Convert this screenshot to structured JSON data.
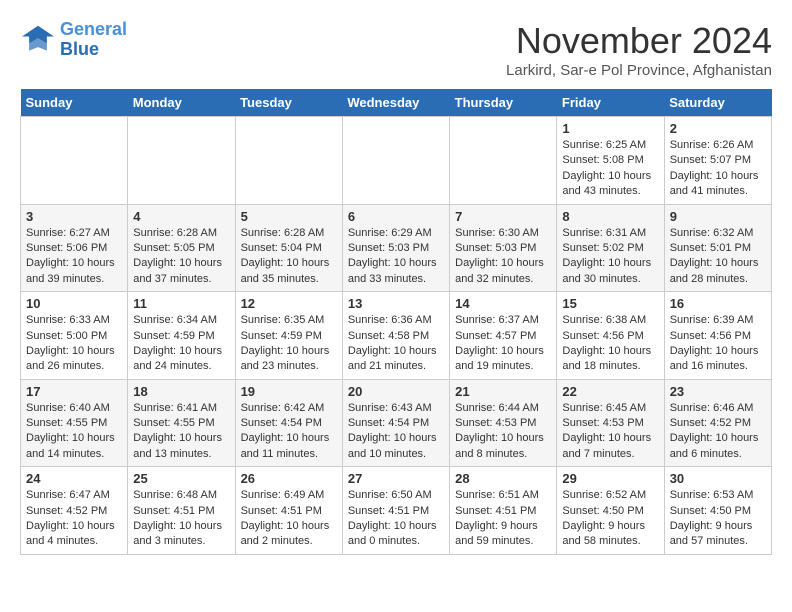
{
  "header": {
    "logo_line1": "General",
    "logo_line2": "Blue",
    "month": "November 2024",
    "location": "Larkird, Sar-e Pol Province, Afghanistan"
  },
  "weekdays": [
    "Sunday",
    "Monday",
    "Tuesday",
    "Wednesday",
    "Thursday",
    "Friday",
    "Saturday"
  ],
  "weeks": [
    [
      {
        "day": "",
        "info": ""
      },
      {
        "day": "",
        "info": ""
      },
      {
        "day": "",
        "info": ""
      },
      {
        "day": "",
        "info": ""
      },
      {
        "day": "",
        "info": ""
      },
      {
        "day": "1",
        "info": "Sunrise: 6:25 AM\nSunset: 5:08 PM\nDaylight: 10 hours and 43 minutes."
      },
      {
        "day": "2",
        "info": "Sunrise: 6:26 AM\nSunset: 5:07 PM\nDaylight: 10 hours and 41 minutes."
      }
    ],
    [
      {
        "day": "3",
        "info": "Sunrise: 6:27 AM\nSunset: 5:06 PM\nDaylight: 10 hours and 39 minutes."
      },
      {
        "day": "4",
        "info": "Sunrise: 6:28 AM\nSunset: 5:05 PM\nDaylight: 10 hours and 37 minutes."
      },
      {
        "day": "5",
        "info": "Sunrise: 6:28 AM\nSunset: 5:04 PM\nDaylight: 10 hours and 35 minutes."
      },
      {
        "day": "6",
        "info": "Sunrise: 6:29 AM\nSunset: 5:03 PM\nDaylight: 10 hours and 33 minutes."
      },
      {
        "day": "7",
        "info": "Sunrise: 6:30 AM\nSunset: 5:03 PM\nDaylight: 10 hours and 32 minutes."
      },
      {
        "day": "8",
        "info": "Sunrise: 6:31 AM\nSunset: 5:02 PM\nDaylight: 10 hours and 30 minutes."
      },
      {
        "day": "9",
        "info": "Sunrise: 6:32 AM\nSunset: 5:01 PM\nDaylight: 10 hours and 28 minutes."
      }
    ],
    [
      {
        "day": "10",
        "info": "Sunrise: 6:33 AM\nSunset: 5:00 PM\nDaylight: 10 hours and 26 minutes."
      },
      {
        "day": "11",
        "info": "Sunrise: 6:34 AM\nSunset: 4:59 PM\nDaylight: 10 hours and 24 minutes."
      },
      {
        "day": "12",
        "info": "Sunrise: 6:35 AM\nSunset: 4:59 PM\nDaylight: 10 hours and 23 minutes."
      },
      {
        "day": "13",
        "info": "Sunrise: 6:36 AM\nSunset: 4:58 PM\nDaylight: 10 hours and 21 minutes."
      },
      {
        "day": "14",
        "info": "Sunrise: 6:37 AM\nSunset: 4:57 PM\nDaylight: 10 hours and 19 minutes."
      },
      {
        "day": "15",
        "info": "Sunrise: 6:38 AM\nSunset: 4:56 PM\nDaylight: 10 hours and 18 minutes."
      },
      {
        "day": "16",
        "info": "Sunrise: 6:39 AM\nSunset: 4:56 PM\nDaylight: 10 hours and 16 minutes."
      }
    ],
    [
      {
        "day": "17",
        "info": "Sunrise: 6:40 AM\nSunset: 4:55 PM\nDaylight: 10 hours and 14 minutes."
      },
      {
        "day": "18",
        "info": "Sunrise: 6:41 AM\nSunset: 4:55 PM\nDaylight: 10 hours and 13 minutes."
      },
      {
        "day": "19",
        "info": "Sunrise: 6:42 AM\nSunset: 4:54 PM\nDaylight: 10 hours and 11 minutes."
      },
      {
        "day": "20",
        "info": "Sunrise: 6:43 AM\nSunset: 4:54 PM\nDaylight: 10 hours and 10 minutes."
      },
      {
        "day": "21",
        "info": "Sunrise: 6:44 AM\nSunset: 4:53 PM\nDaylight: 10 hours and 8 minutes."
      },
      {
        "day": "22",
        "info": "Sunrise: 6:45 AM\nSunset: 4:53 PM\nDaylight: 10 hours and 7 minutes."
      },
      {
        "day": "23",
        "info": "Sunrise: 6:46 AM\nSunset: 4:52 PM\nDaylight: 10 hours and 6 minutes."
      }
    ],
    [
      {
        "day": "24",
        "info": "Sunrise: 6:47 AM\nSunset: 4:52 PM\nDaylight: 10 hours and 4 minutes."
      },
      {
        "day": "25",
        "info": "Sunrise: 6:48 AM\nSunset: 4:51 PM\nDaylight: 10 hours and 3 minutes."
      },
      {
        "day": "26",
        "info": "Sunrise: 6:49 AM\nSunset: 4:51 PM\nDaylight: 10 hours and 2 minutes."
      },
      {
        "day": "27",
        "info": "Sunrise: 6:50 AM\nSunset: 4:51 PM\nDaylight: 10 hours and 0 minutes."
      },
      {
        "day": "28",
        "info": "Sunrise: 6:51 AM\nSunset: 4:51 PM\nDaylight: 9 hours and 59 minutes."
      },
      {
        "day": "29",
        "info": "Sunrise: 6:52 AM\nSunset: 4:50 PM\nDaylight: 9 hours and 58 minutes."
      },
      {
        "day": "30",
        "info": "Sunrise: 6:53 AM\nSunset: 4:50 PM\nDaylight: 9 hours and 57 minutes."
      }
    ]
  ]
}
